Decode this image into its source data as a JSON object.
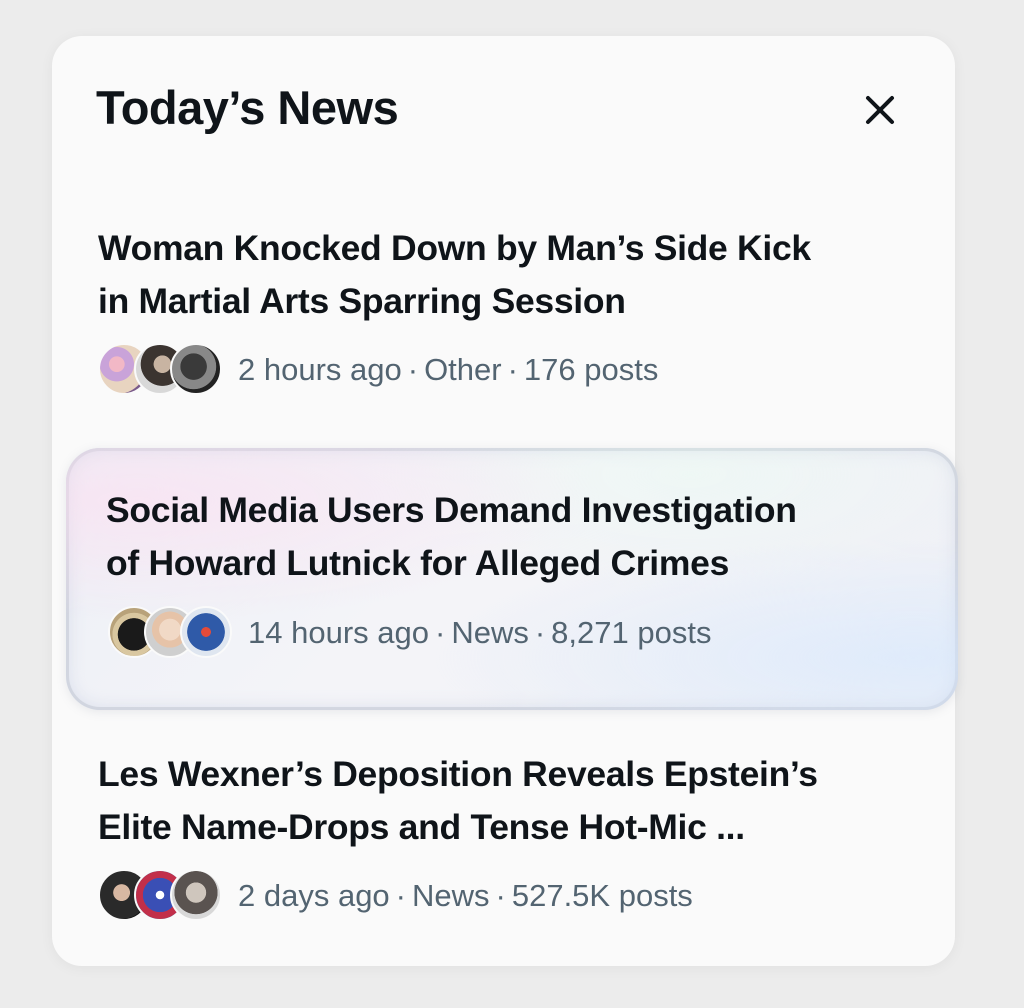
{
  "header": {
    "title": "Today’s News",
    "close_icon": "close-icon"
  },
  "items": [
    {
      "title_line1": "Woman Knocked Down by Man’s Side Kick",
      "title_line2": "in Martial Arts Sparring Session",
      "time": "2 hours ago",
      "category": "Other",
      "posts": "176 posts",
      "separator": "·",
      "highlighted": false
    },
    {
      "title_line1": "Social Media Users Demand Investigation",
      "title_line2": "of Howard Lutnick for Alleged Crimes",
      "time": "14 hours ago",
      "category": "News",
      "posts": "8,271 posts",
      "separator": "·",
      "highlighted": true
    },
    {
      "title_line1": "Les Wexner’s Deposition Reveals Epstein’s",
      "title_line2": "Elite Name-Drops and Tense Hot-Mic ...",
      "time": "2 days ago",
      "category": "News",
      "posts": "527.5K posts",
      "separator": "·",
      "highlighted": false
    }
  ],
  "colors": {
    "title_text": "#0f1419",
    "meta_text": "#536471",
    "panel_bg": "#fafafa",
    "page_bg": "#ececec"
  }
}
